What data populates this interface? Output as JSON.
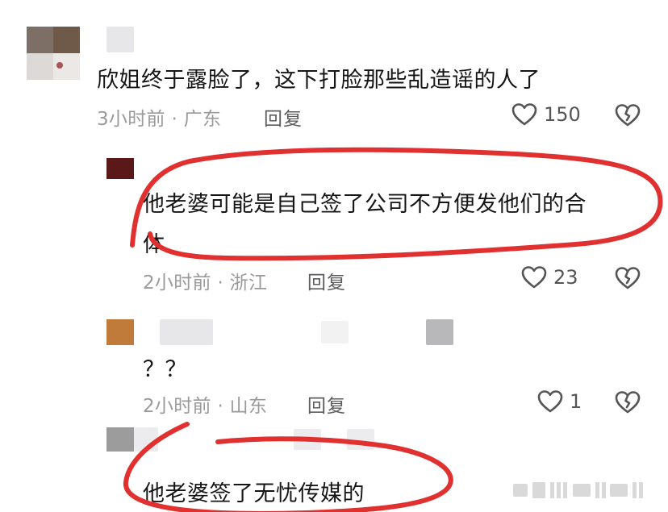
{
  "comments": [
    {
      "text": "欣姐终于露脸了，这下打脸那些乱造谣的人了",
      "meta": "3小时前 · 广东",
      "reply_label": "回复",
      "likes": "150"
    },
    {
      "text_line1": "他老婆可能是自己签了公司不方便发他们的合",
      "text_line2": "体",
      "meta": "2小时前 · 浙江",
      "reply_label": "回复",
      "likes": "23"
    },
    {
      "text": "？？",
      "meta": "2小时前 · 山东",
      "reply_label": "回复",
      "likes": "1"
    },
    {
      "text": "他老婆签了无忧传媒的"
    }
  ],
  "colors": {
    "annotation_red": "#e0302f",
    "like_icon": "#555555"
  },
  "icons": {
    "like": "heart-outline-icon",
    "dislike": "broken-heart-icon"
  }
}
